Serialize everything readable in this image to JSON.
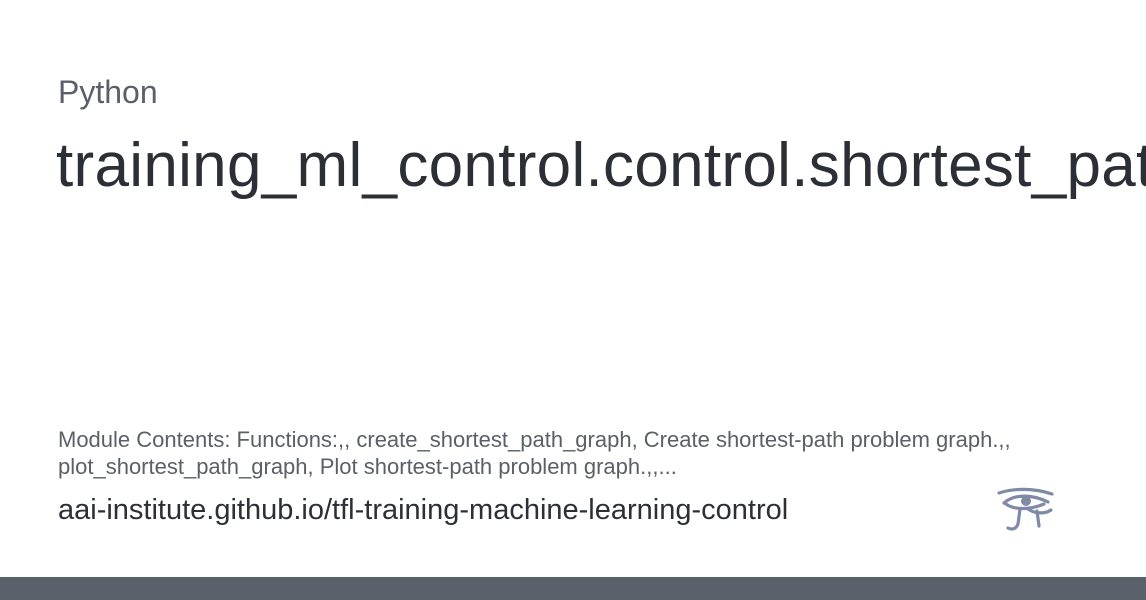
{
  "card": {
    "eyebrow": "Python",
    "title": "training_ml_control.control.shortest_path",
    "description": "Module Contents: Functions:,, create_shortest_path_graph, Create shortest-path problem graph.,, plot_shortest_path_graph, Plot shortest-path problem graph.,,...",
    "url": "aai-institute.github.io/tfl-training-machine-learning-control",
    "logo_icon": "eye-of-horus-icon"
  },
  "colors": {
    "text_primary": "#2c2f36",
    "text_secondary": "#5b6068",
    "logo": "#7f8aa6",
    "bottom_bar": "#5b616b",
    "background": "#ffffff"
  }
}
